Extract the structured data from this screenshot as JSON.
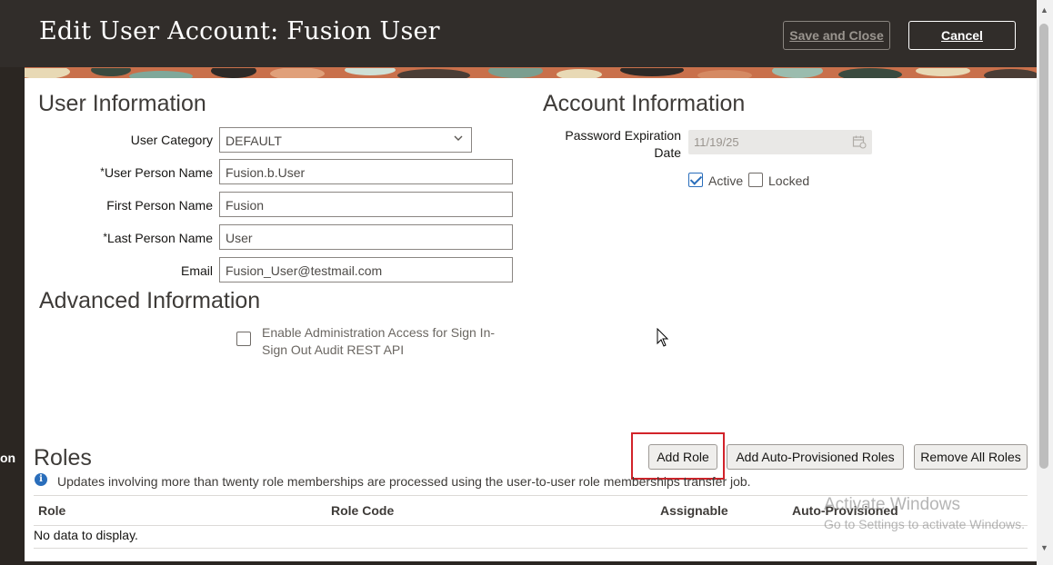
{
  "header": {
    "title": "Edit User Account: Fusion User",
    "save_close_label": "Save and Close",
    "cancel_label": "Cancel"
  },
  "background_page": {
    "clipped_text": "on"
  },
  "user_information": {
    "heading": "User Information",
    "user_category": {
      "label": "User Category",
      "value": "DEFAULT"
    },
    "user_person_name": {
      "required_mark": "*",
      "label": "User Person Name",
      "value": "Fusion.b.User"
    },
    "first_person_name": {
      "label": "First Person Name",
      "value": "Fusion"
    },
    "last_person_name": {
      "required_mark": "*",
      "label": "Last Person Name",
      "value": "User"
    },
    "email": {
      "label": "Email",
      "value": "Fusion_User@testmail.com"
    }
  },
  "account_information": {
    "heading": "Account Information",
    "password_expiration_label_line1": "Password Expiration",
    "password_expiration_label_line2": "Date",
    "password_expiration_value": "11/19/25",
    "active": {
      "label": "Active",
      "checked": true
    },
    "locked": {
      "label": "Locked",
      "checked": false
    }
  },
  "advanced_information": {
    "heading": "Advanced Information",
    "admin_access_line1": "Enable Administration Access for Sign In-",
    "admin_access_line2": "Sign Out Audit REST API",
    "admin_access_checked": false
  },
  "roles": {
    "heading": "Roles",
    "add_role_label": "Add Role",
    "add_auto_label": "Add Auto-Provisioned Roles",
    "remove_all_label": "Remove All Roles",
    "info_text": "Updates involving more than twenty role memberships are processed using the user-to-user role memberships transfer job.",
    "columns": [
      "Role",
      "Role Code",
      "Assignable",
      "Auto-Provisioned"
    ],
    "empty_text": "No data to display."
  },
  "watermark": {
    "line1": "Activate Windows",
    "line2": "Go to Settings to activate Windows."
  },
  "colors": {
    "header_bg": "#312d2a",
    "accent_blue": "#2a6ebb",
    "highlight_red": "#d2232a"
  }
}
